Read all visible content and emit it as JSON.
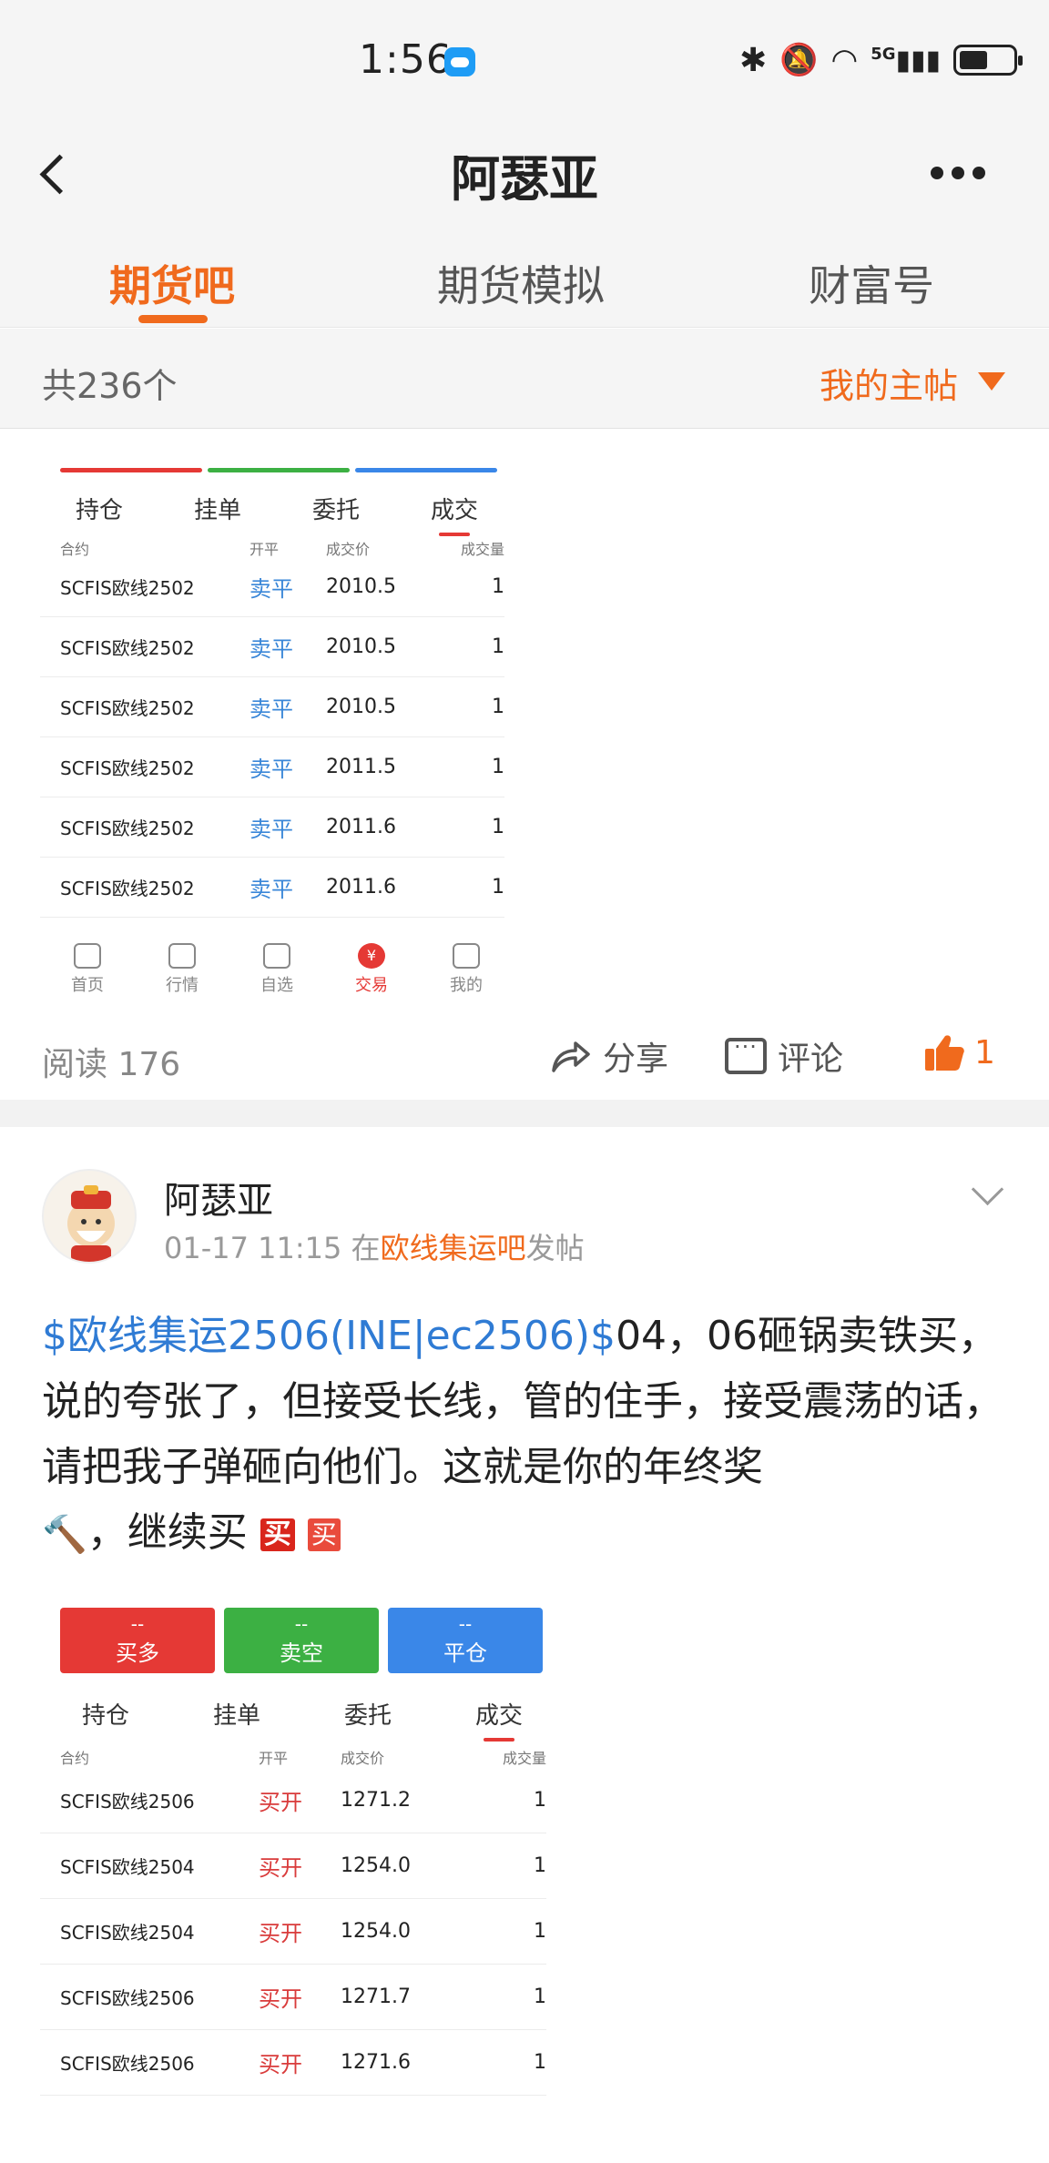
{
  "status_bar": {
    "time": "1:56",
    "network": "5G"
  },
  "header": {
    "title": "阿瑟亚"
  },
  "tabs": [
    {
      "label": "期货吧",
      "active": true
    },
    {
      "label": "期货模拟",
      "active": false
    },
    {
      "label": "财富号",
      "active": false
    }
  ],
  "filter": {
    "count": "共236个",
    "sort_label": "我的主帖"
  },
  "post1": {
    "trade_screenshot": {
      "tabs": [
        "持仓",
        "挂单",
        "委托",
        "成交"
      ],
      "active_tab": "成交",
      "columns": [
        "合约",
        "开平",
        "成交价",
        "成交量"
      ],
      "rows": [
        {
          "contract": "SCFIS欧线2502",
          "open_close": "卖平",
          "price": "2010.5",
          "qty": "1"
        },
        {
          "contract": "SCFIS欧线2502",
          "open_close": "卖平",
          "price": "2010.5",
          "qty": "1"
        },
        {
          "contract": "SCFIS欧线2502",
          "open_close": "卖平",
          "price": "2010.5",
          "qty": "1"
        },
        {
          "contract": "SCFIS欧线2502",
          "open_close": "卖平",
          "price": "2011.5",
          "qty": "1"
        },
        {
          "contract": "SCFIS欧线2502",
          "open_close": "卖平",
          "price": "2011.6",
          "qty": "1"
        },
        {
          "contract": "SCFIS欧线2502",
          "open_close": "卖平",
          "price": "2011.6",
          "qty": "1"
        }
      ],
      "nav": [
        "首页",
        "行情",
        "自选",
        "交易",
        "我的"
      ],
      "nav_active": "交易",
      "nav_trade_symbol": "¥"
    },
    "read_label": "阅读 176",
    "share_label": "分享",
    "comment_label": "评论",
    "like_count": "1"
  },
  "post2": {
    "author": "阿瑟亚",
    "time": "01-17 11:15",
    "meta_prefix": "在",
    "bar_name": "欧线集运吧",
    "meta_suffix": "发帖",
    "stock_link": "$欧线集运2506(INE|ec2506)$",
    "body_text": "04，06砸锅卖铁买，说的夸张了，但接受长线，管的住手，接受震荡的话，请把我子弹砸向他们。这就是你的年终奖",
    "body_tail": "，继续买",
    "emoji_buy": "买",
    "emoji_buy2": "买",
    "trade_screenshot": {
      "buttons": [
        {
          "dash": "--",
          "label": "买多",
          "color": "#e53935"
        },
        {
          "dash": "--",
          "label": "卖空",
          "color": "#3cb043"
        },
        {
          "dash": "--",
          "label": "平仓",
          "color": "#3a87e8"
        }
      ],
      "tabs": [
        "持仓",
        "挂单",
        "委托",
        "成交"
      ],
      "active_tab": "成交",
      "columns": [
        "合约",
        "开平",
        "成交价",
        "成交量"
      ],
      "rows": [
        {
          "contract": "SCFIS欧线2506",
          "open_close": "买开",
          "price": "1271.2",
          "qty": "1"
        },
        {
          "contract": "SCFIS欧线2504",
          "open_close": "买开",
          "price": "1254.0",
          "qty": "1"
        },
        {
          "contract": "SCFIS欧线2504",
          "open_close": "买开",
          "price": "1254.0",
          "qty": "1"
        },
        {
          "contract": "SCFIS欧线2506",
          "open_close": "买开",
          "price": "1271.7",
          "qty": "1"
        },
        {
          "contract": "SCFIS欧线2506",
          "open_close": "买开",
          "price": "1271.6",
          "qty": "1"
        }
      ]
    }
  },
  "colors": {
    "accent": "#f06a1d",
    "link": "#2f7bd4",
    "sell": "#3a87d8",
    "buy": "#d93b3b"
  }
}
